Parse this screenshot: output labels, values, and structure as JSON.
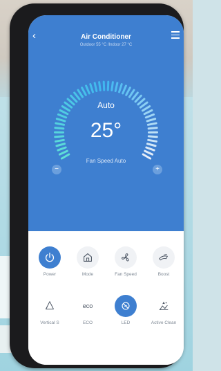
{
  "header": {
    "title": "Air Conditioner",
    "subtitle": "Outdoor 55 °C /Indoor 27 °C"
  },
  "status": {
    "mode": "Auto",
    "temperature": "25°",
    "fan_speed": "Fan Speed Auto",
    "dial_level_percent": 50
  },
  "buttons": {
    "minus": "−",
    "plus": "+"
  },
  "controls": [
    {
      "label": "Power",
      "icon": "power-icon",
      "active": true
    },
    {
      "label": "Mode",
      "icon": "home-icon",
      "active": false
    },
    {
      "label": "Fan Speed",
      "icon": "fan-icon",
      "active": false
    },
    {
      "label": "Boost",
      "icon": "boost-icon",
      "active": false
    },
    {
      "label": "Vertical S",
      "icon": "vertical-swing-icon",
      "active": false
    },
    {
      "label": "ECO",
      "icon": "eco-icon",
      "active": false
    },
    {
      "label": "LED",
      "icon": "led-icon",
      "active": true
    },
    {
      "label": "Active Clean",
      "icon": "active-clean-icon",
      "active": false
    }
  ],
  "eco_icon_text": "eco",
  "colors": {
    "primary": "#3e7fd0",
    "dial_start": "#5fe0d6",
    "dial_end": "#e8eef8"
  }
}
